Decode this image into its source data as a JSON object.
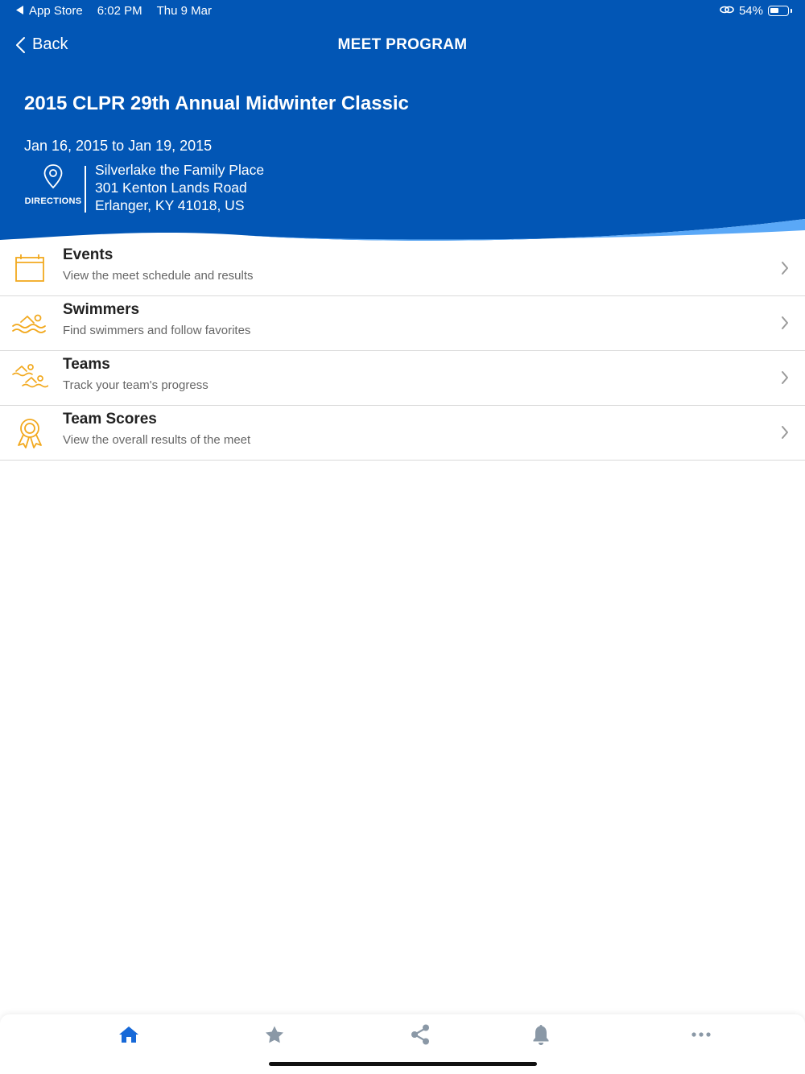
{
  "status_bar": {
    "back_app": "App Store",
    "time": "6:02 PM",
    "date": "Thu 9 Mar",
    "battery": "54%",
    "battery_level": 0.54
  },
  "nav": {
    "back_label": "Back",
    "title": "MEET PROGRAM"
  },
  "meet": {
    "title": "2015 CLPR 29th Annual Midwinter Classic",
    "dates": "Jan 16, 2015 to Jan 19, 2015",
    "directions_label": "DIRECTIONS",
    "address_line1": "Silverlake the Family Place",
    "address_line2": "301 Kenton Lands Road",
    "address_line3": "Erlanger, KY 41018, US"
  },
  "menu": [
    {
      "title": "Events",
      "subtitle": "View the meet schedule and results",
      "icon": "calendar-icon"
    },
    {
      "title": "Swimmers",
      "subtitle": "Find swimmers and follow favorites",
      "icon": "swimmer-icon"
    },
    {
      "title": "Teams",
      "subtitle": "Track your team's progress",
      "icon": "team-swimmers-icon"
    },
    {
      "title": "Team Scores",
      "subtitle": "View the overall results of the meet",
      "icon": "award-ribbon-icon"
    }
  ],
  "tab_bar": {
    "items": [
      "home-icon",
      "star-icon",
      "share-icon",
      "bell-icon",
      "more-icon"
    ],
    "active": "home-icon"
  },
  "colors": {
    "header_blue": "#0256b5",
    "wave_light_blue": "#5aa8f7",
    "accent_orange": "#f2a91f",
    "active_tab": "#1769d8",
    "inactive_tab": "#8a98a6"
  }
}
